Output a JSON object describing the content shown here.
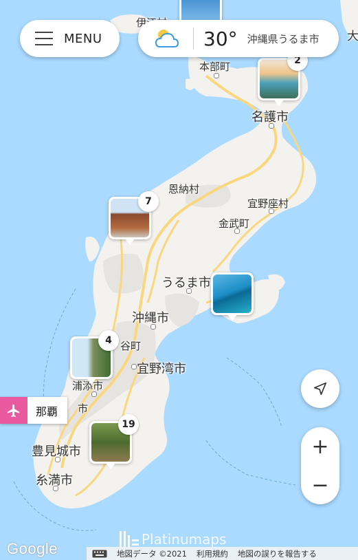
{
  "menu": {
    "label": "MENU"
  },
  "weather": {
    "temperature": "30°",
    "location": "沖縄県うるま市",
    "icon": "partly-cloudy-icon"
  },
  "markers": [
    {
      "id": "top",
      "count": ""
    },
    {
      "id": "motobu",
      "count": "2"
    },
    {
      "id": "onna",
      "count": "7"
    },
    {
      "id": "uruma",
      "count": ""
    },
    {
      "id": "chatan",
      "count": "4"
    },
    {
      "id": "nanjo",
      "count": "19"
    }
  ],
  "airport": {
    "label": "那覇",
    "icon": "airplane-icon"
  },
  "places": {
    "iheya": "伊江村",
    "motobu": "本部町",
    "nago": "名護市",
    "onna": "恩納村",
    "ginoza": "宜野座村",
    "kin": "金武町",
    "uruma": "うるま市",
    "okinawa": "沖縄市",
    "chatan": "谷町",
    "ginowan": "宜野湾市",
    "urasoe": "浦添市",
    "naha": "市",
    "tomigusuku": "豊見城市",
    "itoman": "糸満市",
    "ie_edge": "大"
  },
  "controls": {
    "zoom_in": "+",
    "zoom_out": "−"
  },
  "footer": {
    "google": "Google",
    "watermark": "Platinumaps",
    "map_data": "地図データ ©2021",
    "terms": "利用規約",
    "report": "地図の誤りを報告する"
  },
  "colors": {
    "water": "#aadaff",
    "land": "#f4f2ee",
    "urban": "#e6e4e0",
    "road": "#f9d77e",
    "airport_accent": "#e8599f"
  }
}
